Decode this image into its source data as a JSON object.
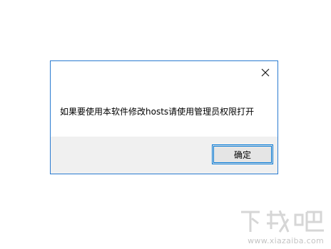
{
  "dialog": {
    "message": "如果要使用本软件修改hosts请使用管理员权限打开",
    "ok_label": "确定",
    "close_icon": "close-icon",
    "border_color": "#2a7bd1",
    "footer_color": "#f0f0f0",
    "ok_border_color": "#0078d7"
  },
  "watermark": {
    "logo_text": "下载吧",
    "url": "www.xiazaiba.com"
  }
}
